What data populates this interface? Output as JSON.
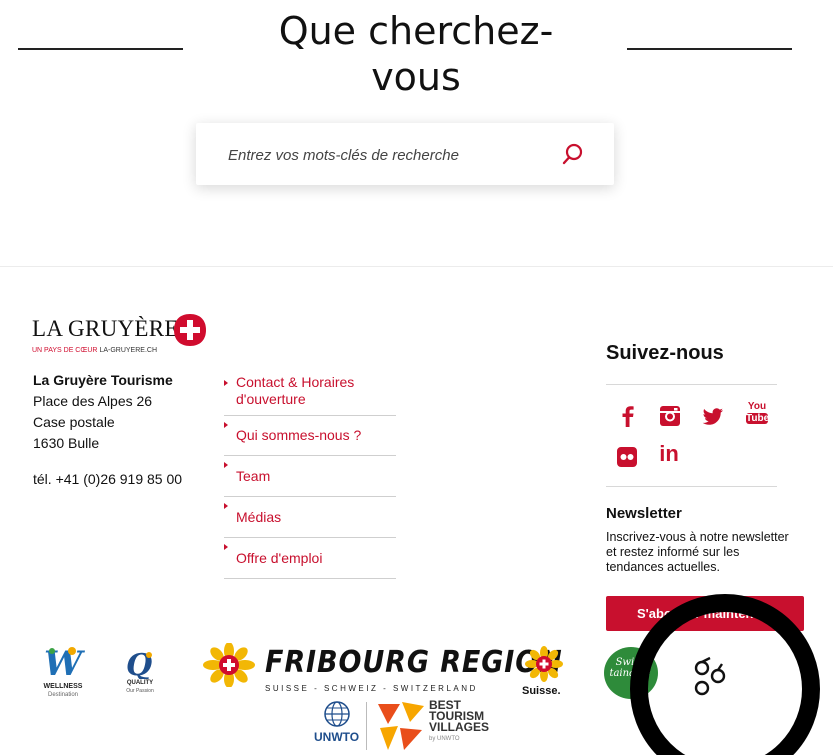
{
  "search": {
    "title_line1": "Que cherchez-",
    "title_line2": "vous",
    "placeholder": "Entrez vos mots-clés de recherche"
  },
  "brand": {
    "name": "LA GRUYÈRE",
    "tagline": "UN PAYS DE CŒUR",
    "website": "LA-GRUYERE.CH"
  },
  "address": {
    "org": "La Gruyère Tourisme",
    "street": "Place des Alpes 26",
    "box": "Case postale",
    "city": "1630 Bulle",
    "phone": "tél. +41 (0)26 919 85 00"
  },
  "footer_links": [
    {
      "line1": "Contact & Horaires",
      "line2": "d'ouverture"
    },
    {
      "line1": "Qui sommes-nous ?",
      "line2": ""
    },
    {
      "line1": "Team",
      "line2": ""
    },
    {
      "line1": "Médias",
      "line2": ""
    },
    {
      "line1": "Offre d'emploi",
      "line2": ""
    }
  ],
  "social": {
    "title": "Suivez-nous",
    "youtube_line1": "You",
    "youtube_line2": "Tube",
    "linkedin": "in"
  },
  "newsletter": {
    "title": "Newsletter",
    "text": "Inscrivez-vous à notre newsletter et restez informé sur les tendances actuelles.",
    "button": "S'abonner maintenant"
  },
  "partners": {
    "wellness": "WELLNESS",
    "wellness_sub": "Destination",
    "quality": "QUALITY",
    "quality_sub": "Our Passion",
    "fribourg": "FRIBOURG REGION",
    "fribourg_sub": "SUISSE - SCHWEIZ - SWITZERLAND",
    "suisse": "Suisse.",
    "unwto": "UNWTO",
    "btv1": "BEST",
    "btv2": "TOURISM",
    "btv3": "VILLAGES",
    "btv_by": "by UNWTO",
    "stamp_line1": "Swiss",
    "stamp_line2": "tainable"
  },
  "colors": {
    "accent": "#c8102e",
    "text": "#111111",
    "rule": "#d8d8d8"
  }
}
